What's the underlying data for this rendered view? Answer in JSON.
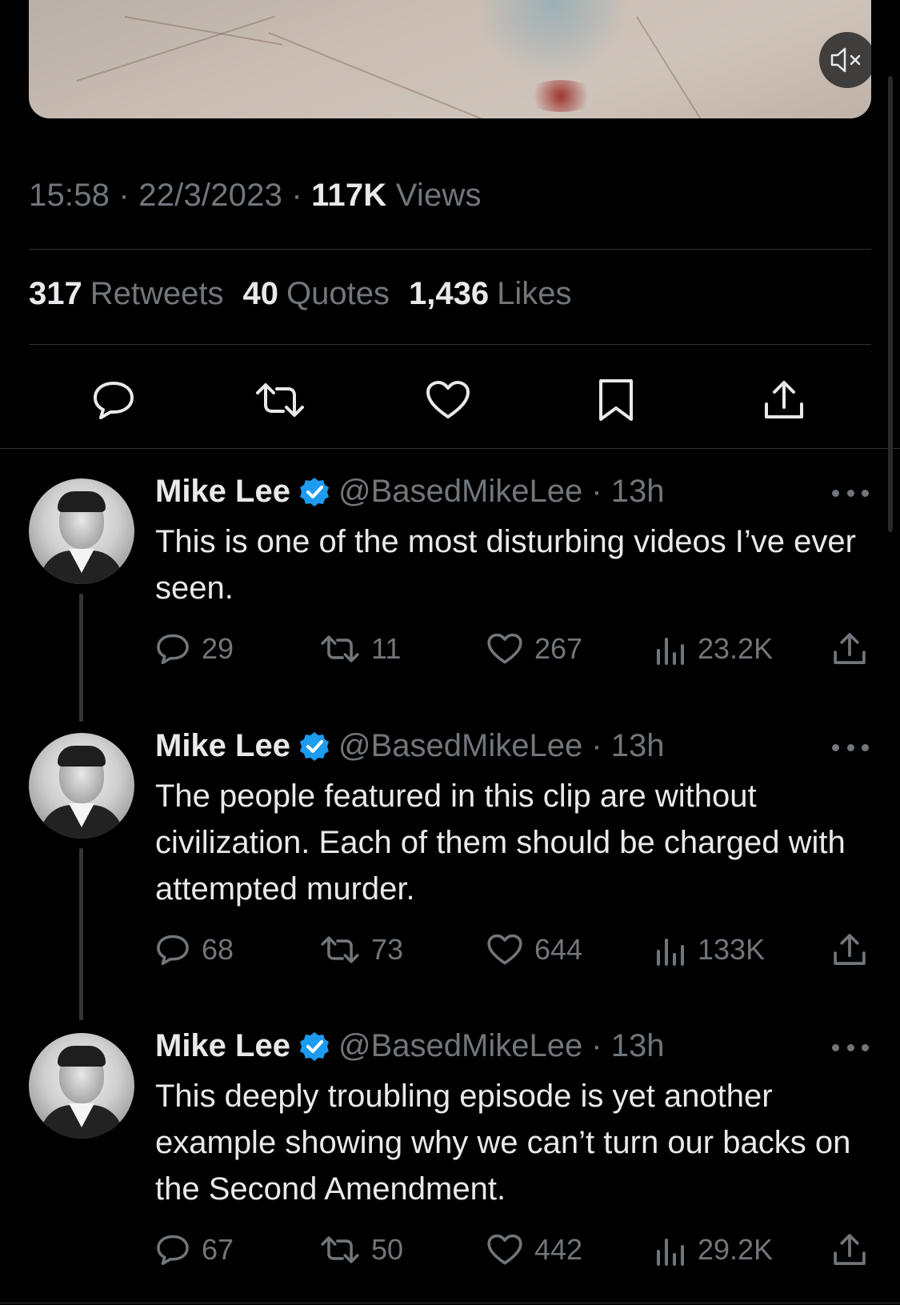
{
  "tweet": {
    "time": "15:58",
    "date": "22/3/2023",
    "views_count": "117K",
    "views_label": "Views",
    "retweets_count": "317",
    "retweets_label": "Retweets",
    "quotes_count": "40",
    "quotes_label": "Quotes",
    "likes_count": "1,436",
    "likes_label": "Likes"
  },
  "colors": {
    "background": "#000000",
    "text": "#e7e9ea",
    "muted": "#71767b",
    "verified": "#1d9bf0",
    "divider": "#2f3336"
  },
  "replies": [
    {
      "name": "Mike Lee",
      "handle": "@BasedMikeLee",
      "time": "13h",
      "text": "This is one of the most disturbing videos I’ve ever seen.",
      "replies": "29",
      "retweets": "11",
      "likes": "267",
      "views": "23.2K"
    },
    {
      "name": "Mike Lee",
      "handle": "@BasedMikeLee",
      "time": "13h",
      "text": "The people featured in this clip are without civilization. Each of them should be charged with attempted murder.",
      "replies": "68",
      "retweets": "73",
      "likes": "644",
      "views": "133K"
    },
    {
      "name": "Mike Lee",
      "handle": "@BasedMikeLee",
      "time": "13h",
      "text": "This deeply troubling episode is yet another example showing why we can’t turn our backs on the Second Amendment.",
      "replies": "67",
      "retweets": "50",
      "likes": "442",
      "views": "29.2K"
    }
  ],
  "icons": [
    "mute-icon",
    "reply-icon",
    "retweet-icon",
    "like-icon",
    "bookmark-icon",
    "share-icon",
    "verified-icon",
    "more-icon",
    "views-icon"
  ]
}
